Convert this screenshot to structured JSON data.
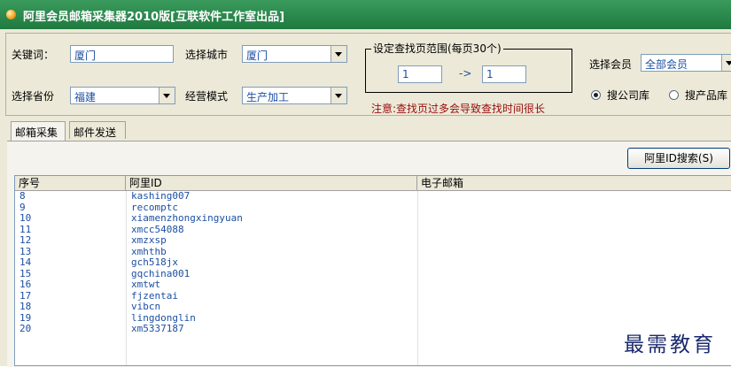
{
  "window": {
    "title": "阿里会员邮箱采集器2010版[互联软件工作室出品]"
  },
  "form": {
    "keyword_label": "关键词：",
    "keyword_value": "厦门",
    "city_label": "选择城市",
    "city_value": "厦门",
    "province_label": "选择省份",
    "province_value": "福建",
    "mode_label": "经营模式",
    "mode_value": "生产加工",
    "page_range_title": "设定查找页范围(每页30个)",
    "page_from": "1",
    "page_arrow": "->",
    "page_to": "1",
    "note": "注意:查找页过多会导致查找时间很长",
    "member_label": "选择会员",
    "member_value": "全部会员",
    "radio_company": "搜公司库",
    "radio_product": "搜产品库"
  },
  "tabs": [
    {
      "label": "邮箱采集",
      "active": true
    },
    {
      "label": "邮件发送",
      "active": false
    }
  ],
  "toolbar": {
    "search_button": "阿里ID搜索(S)"
  },
  "table": {
    "columns": [
      "序号",
      "阿里ID",
      "电子邮箱"
    ],
    "rows": [
      {
        "num": "8",
        "id": "kashing007",
        "email": ""
      },
      {
        "num": "9",
        "id": "recomptc",
        "email": ""
      },
      {
        "num": "10",
        "id": "xiamenzhongxingyuan",
        "email": ""
      },
      {
        "num": "11",
        "id": "xmcc54088",
        "email": ""
      },
      {
        "num": "12",
        "id": "xmzxsp",
        "email": ""
      },
      {
        "num": "13",
        "id": "xmhthb",
        "email": ""
      },
      {
        "num": "14",
        "id": "gch518jx",
        "email": ""
      },
      {
        "num": "15",
        "id": "gqchina001",
        "email": ""
      },
      {
        "num": "16",
        "id": "xmtwt",
        "email": ""
      },
      {
        "num": "17",
        "id": "fjzentai",
        "email": ""
      },
      {
        "num": "18",
        "id": "vibcn",
        "email": ""
      },
      {
        "num": "19",
        "id": "lingdonglin",
        "email": ""
      },
      {
        "num": "20",
        "id": "xm5337187",
        "email": ""
      }
    ]
  },
  "watermark": "最需教育"
}
